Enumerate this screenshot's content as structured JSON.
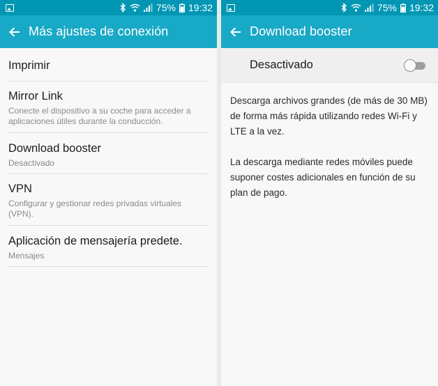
{
  "status_bar": {
    "battery": "75%",
    "time": "19:32"
  },
  "left_screen": {
    "title": "Más ajustes de conexión",
    "items": [
      {
        "title": "Imprimir"
      },
      {
        "title": "Mirror Link",
        "subtitle": "Conecte el dispositivo a su coche para acceder a aplicaciones útiles durante la conducción."
      },
      {
        "title": "Download booster",
        "subtitle": "Desactivado"
      },
      {
        "title": "VPN",
        "subtitle": "Configurar y gestionar redes privadas virtuales (VPN)."
      },
      {
        "title": "Aplicación de mensajería predete.",
        "subtitle": "Mensajes"
      }
    ]
  },
  "right_screen": {
    "title": "Download booster",
    "toggle": {
      "label": "Desactivado",
      "state": "off"
    },
    "description": [
      "Descarga archivos grandes (de más de 30 MB) de forma más rápida utilizando redes Wi-Fi y LTE a la vez.",
      "La descarga mediante redes móviles puede suponer costes adicionales en función de su plan de pago."
    ]
  },
  "colors": {
    "status_bar": "#0096b4",
    "app_bar": "#18a9c6",
    "background": "#f8f8f8",
    "divider": "#dedede"
  },
  "icons": [
    "gallery-icon",
    "bluetooth-icon",
    "wifi-icon",
    "signal-icon",
    "battery-icon",
    "back-arrow-icon",
    "toggle-switch"
  ]
}
